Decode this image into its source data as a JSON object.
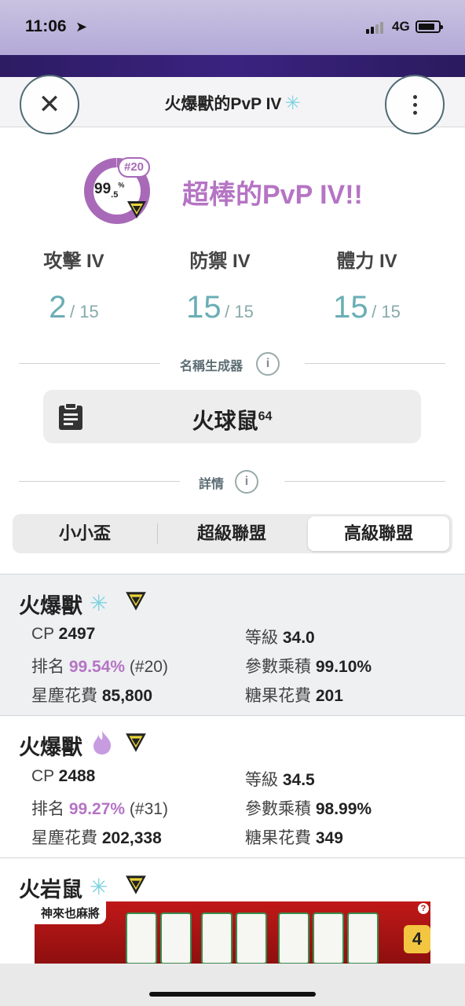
{
  "status": {
    "time": "11:06",
    "network": "4G"
  },
  "header": {
    "title": "火爆獸的PvP IV",
    "title_icon": "snowflake-icon"
  },
  "rank": {
    "badge": "#20",
    "percent_main": "99",
    "percent_dec": ".5",
    "percent_sign": "%",
    "fill_fraction": 0.995,
    "color": "#a86ab8"
  },
  "headline": "超棒的PvP IV!!",
  "ivs": [
    {
      "label": "攻擊 IV",
      "value": "2",
      "max": "/ 15"
    },
    {
      "label": "防禦 IV",
      "value": "15",
      "max": "/ 15"
    },
    {
      "label": "體力 IV",
      "value": "15",
      "max": "/ 15"
    }
  ],
  "name_generator": {
    "section": "名稱生成器",
    "name": "火球鼠",
    "suffix": "64"
  },
  "details": {
    "section": "詳情"
  },
  "leagues": [
    "小小盃",
    "超級聯盟",
    "高級聯盟"
  ],
  "selected_league": "高級聯盟",
  "results": [
    {
      "name": "火爆獸",
      "variant_icon": "snowflake-icon",
      "cp_label": "CP",
      "cp": "2497",
      "level_label": "等級",
      "level": "34.0",
      "rank_label": "排名",
      "rank_pct": "99.54%",
      "rank_num": "(#20)",
      "stat_label": "參數乘積",
      "stat": "99.10%",
      "dust_label": "星塵花費",
      "dust": "85,800",
      "candy_label": "糖果花費",
      "candy": "201"
    },
    {
      "name": "火爆獸",
      "variant_icon": "purple-flame-icon",
      "cp_label": "CP",
      "cp": "2488",
      "level_label": "等級",
      "level": "34.5",
      "rank_label": "排名",
      "rank_pct": "99.27%",
      "rank_num": "(#31)",
      "stat_label": "參數乘積",
      "stat": "98.99%",
      "dust_label": "星塵花費",
      "dust": "202,338",
      "candy_label": "糖果花費",
      "candy": "349"
    },
    {
      "name": "火岩鼠",
      "variant_icon": "snowflake-icon"
    }
  ],
  "ad": {
    "title": "神來也麻將",
    "button_value": "4"
  },
  "colors": {
    "accent_purple": "#b574c4",
    "iv_teal": "#6aaeb5",
    "snow_blue": "#7fd3e0"
  }
}
